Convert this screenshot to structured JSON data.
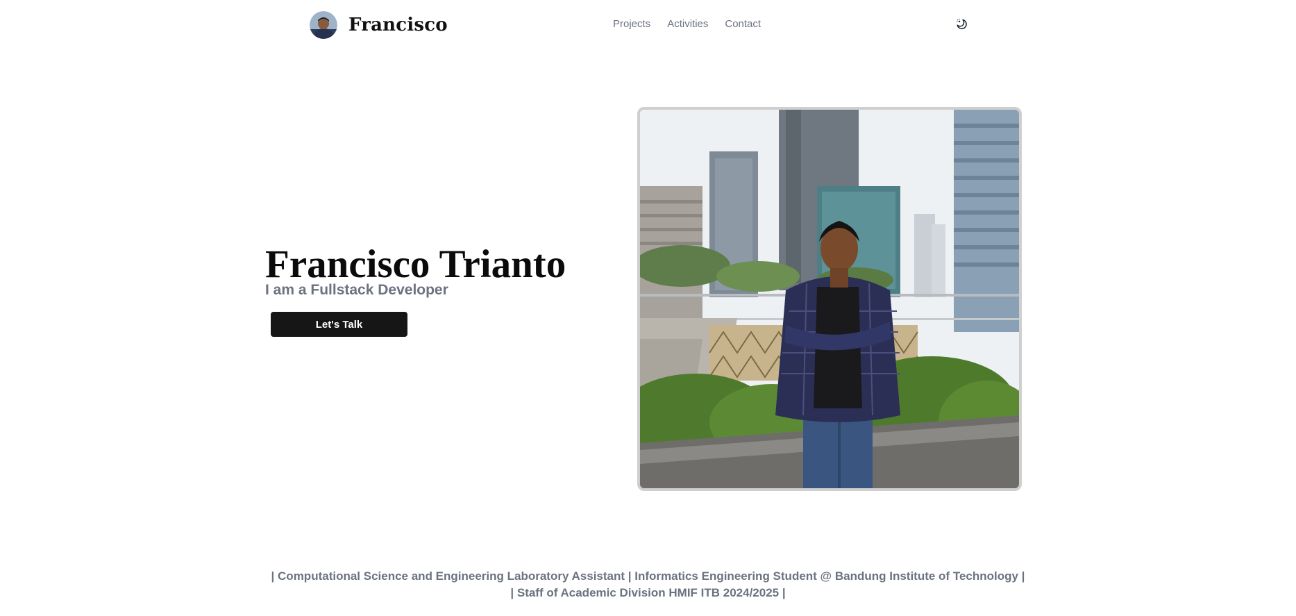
{
  "nav": {
    "brand_name": "Francisco",
    "avatar_icon": "avatar-photo",
    "links": [
      {
        "label": "Projects"
      },
      {
        "label": "Activities"
      },
      {
        "label": "Contact"
      }
    ],
    "theme_toggle_icon": "moon-sun-icon"
  },
  "hero": {
    "name": "Francisco Trianto",
    "subtitle": "I am a Fullstack Developer",
    "cta_label": "Let's Talk",
    "photo": "portrait-photo-city-rooftop"
  },
  "tagline": {
    "line1": "| Computational Science and Engineering Laboratory Assistant | Informatics Engineering Student @ Bandung Institute of Technology |",
    "line2": "| Staff of Academic Division HMIF ITB 2024/2025 |"
  },
  "colors": {
    "text_primary": "#111111",
    "text_muted": "#6b7280",
    "button_bg": "#161616",
    "button_text": "#ffffff",
    "frame_border": "#cfcfcf"
  }
}
